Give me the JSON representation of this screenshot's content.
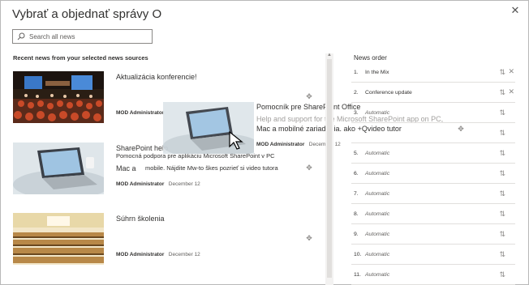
{
  "dialog": {
    "title": "Vybrať a objednať správy O",
    "close_label": "✕"
  },
  "search": {
    "placeholder": "Search all news"
  },
  "recent": {
    "heading": "Recent news from your selected news sources",
    "items": [
      {
        "title": "Aktualizácia konferencie!",
        "author": "MOD Administrator",
        "date": ""
      },
      {
        "title": "SharePoint help",
        "author": "MOD Administrator",
        "date": "December 12"
      },
      {
        "title": "Súhrn školenia",
        "author": "MOD Administrator",
        "date": "December 12"
      }
    ]
  },
  "drag_ghost": {
    "title": "Pomocník pre SharePoint Office",
    "line1": "Help and support for the Microsoft SharePoint app on PC,",
    "line2": "Mac a mobilné zariadenia. ako +Qvideo tutor",
    "author": "MOD Administrator",
    "date": "December 12",
    "label": "Office"
  },
  "overlay": {
    "line1": "Pomocná podpora pre aplikáciu Microsoft SharePoint v PC",
    "line2_prefix": "Mac a",
    "line2": "mobile. Nájdite Mw-to škes pozrieť si video tutora"
  },
  "news_order": {
    "heading": "News order",
    "rows": [
      {
        "num": "1.",
        "label": "In the Mix",
        "auto": false,
        "removable": true
      },
      {
        "num": "2.",
        "label": "Conference update",
        "auto": false,
        "removable": true
      },
      {
        "num": "3.",
        "label": "Automatic",
        "auto": true,
        "removable": false
      },
      {
        "num": "4.",
        "label": "",
        "auto": true,
        "removable": false
      },
      {
        "num": "5.",
        "label": "Automatic",
        "auto": true,
        "removable": false
      },
      {
        "num": "6.",
        "label": "Automatic",
        "auto": true,
        "removable": false
      },
      {
        "num": "7.",
        "label": "Automatic",
        "auto": true,
        "removable": false
      },
      {
        "num": "8.",
        "label": "Automatic",
        "auto": true,
        "removable": false
      },
      {
        "num": "9.",
        "label": "Automatic",
        "auto": true,
        "removable": false
      },
      {
        "num": "10.",
        "label": "Automatic",
        "auto": true,
        "removable": false
      },
      {
        "num": "11.",
        "label": "Automatic",
        "auto": true,
        "removable": false
      }
    ]
  },
  "icons": {
    "sort": "sort-arrows-icon",
    "remove": "close-icon",
    "move": "move-icon",
    "search": "search-icon"
  },
  "colors": {
    "border": "#b9b9b9",
    "text": "#323130",
    "muted": "#605e5c"
  }
}
